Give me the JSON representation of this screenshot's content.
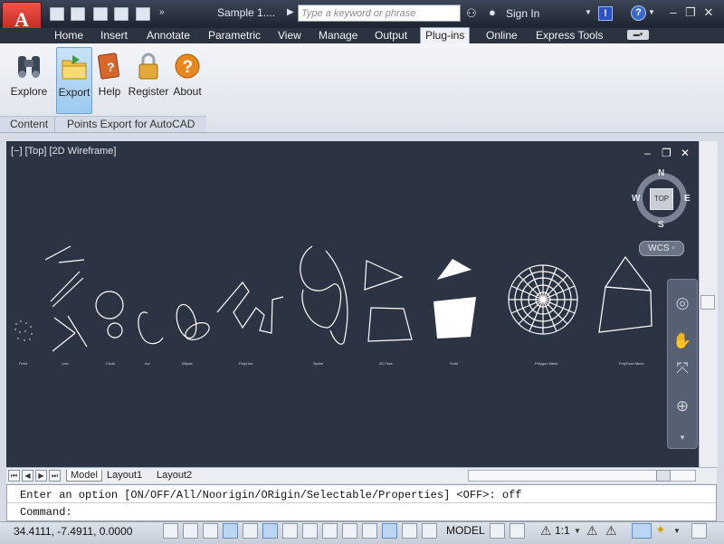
{
  "app": {
    "document_title": "Sample 1....",
    "search_placeholder": "Type a keyword or phrase",
    "sign_in": "Sign In"
  },
  "ribbon_tabs": [
    {
      "label": "Home"
    },
    {
      "label": "Insert"
    },
    {
      "label": "Annotate"
    },
    {
      "label": "Parametric"
    },
    {
      "label": "View"
    },
    {
      "label": "Manage"
    },
    {
      "label": "Output"
    },
    {
      "label": "Plug-ins",
      "active": true
    },
    {
      "label": "Online"
    },
    {
      "label": "Express Tools"
    }
  ],
  "ribbon_buttons": [
    {
      "label": "Explore",
      "icon": "binoculars-icon"
    },
    {
      "label": "Export",
      "icon": "folder-export-icon",
      "active": true
    },
    {
      "label": "Help",
      "icon": "help-book-icon"
    },
    {
      "label": "Register",
      "icon": "padlock-icon"
    },
    {
      "label": "About",
      "icon": "question-icon"
    }
  ],
  "ribbon_panels": [
    {
      "label": "Content"
    },
    {
      "label": "Points Export for AutoCAD"
    }
  ],
  "viewport": {
    "label": "[−] [Top] [2D Wireframe]",
    "viewcube": {
      "top": "TOP",
      "north": "N",
      "south": "S",
      "east": "E",
      "west": "W",
      "wcs": "WCS"
    }
  },
  "drawing_labels": [
    "Point",
    "Line",
    "Circle",
    "Arc",
    "Ellipse",
    "PolyLine",
    "Spline",
    "2D Face",
    "Solid",
    "Polygon Mesh",
    "PolyFace Mesh"
  ],
  "layout_tabs": [
    {
      "label": "Model",
      "active": true
    },
    {
      "label": "Layout1"
    },
    {
      "label": "Layout2"
    }
  ],
  "command_line": {
    "history": "Enter an option [ON/OFF/All/Noorigin/ORigin/Selectable/Properties] <OFF>: off",
    "prompt": "Command:"
  },
  "status_bar": {
    "coordinates": "34.4111, -7.4911, 0.0000",
    "model": "MODEL",
    "annotation_scale": "1:1"
  },
  "colors": {
    "viewport_bg": "#2c3443",
    "drawing_lines": "#ffffff",
    "active_tab": "#eef1f5",
    "title_bar": "#2b3240"
  }
}
